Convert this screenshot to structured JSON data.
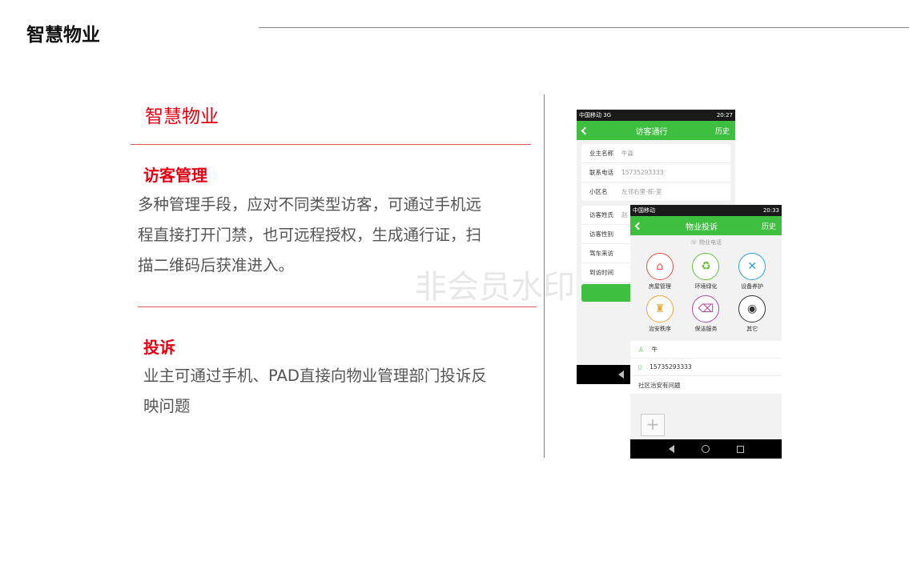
{
  "header": {
    "title": "智慧物业"
  },
  "section": {
    "title": "智慧物业"
  },
  "features": [
    {
      "heading": "访客管理",
      "text": [
        "多种管理手段，应对不同类型访客，可通过手机远",
        "程直接打开门禁，也可远程授权，生成通行证，扫",
        "描二维码后获准进入。"
      ]
    },
    {
      "heading": "投诉",
      "text": [
        "业主可通过手机、PAD直接向物业管理部门投诉反",
        "映问题"
      ]
    }
  ],
  "watermark": "非会员水印",
  "phone1": {
    "status_left": "中国移动 3G",
    "status_time": "20:27",
    "title": "访客通行",
    "right_action": "历史",
    "rows": [
      {
        "label": "业主名称",
        "value": "牛淼"
      },
      {
        "label": "联系电话",
        "value": "15735293333"
      },
      {
        "label": "小区名",
        "value": "左邻右里-栋-室"
      },
      {
        "label": "访客姓氏",
        "value": "赵"
      },
      {
        "label": "访客性别",
        "value": ""
      },
      {
        "label": "驾车来访",
        "value": ""
      },
      {
        "label": "到访时间",
        "value": ""
      }
    ]
  },
  "phone2": {
    "status_left": "中国移动",
    "status_time": "20:33",
    "title": "物业投诉",
    "right_action": "历史",
    "hint": "物业电话",
    "categories": [
      {
        "label": "房屋管理",
        "icon": "house-icon",
        "color": "#e8504a"
      },
      {
        "label": "环境绿化",
        "icon": "recycle-icon",
        "color": "#6cbf3c"
      },
      {
        "label": "设备养护",
        "icon": "tools-icon",
        "color": "#2aa3d8"
      },
      {
        "label": "治安秩序",
        "icon": "security-icon",
        "color": "#e8a93a"
      },
      {
        "label": "保洁服务",
        "icon": "trash-icon",
        "color": "#b24aa8"
      },
      {
        "label": "其它",
        "icon": "other-icon",
        "color": "#333333"
      }
    ],
    "name": "牛",
    "phone": "15735293333",
    "complaint": "社区治安有问题"
  }
}
